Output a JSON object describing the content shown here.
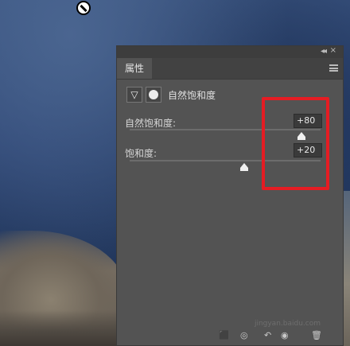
{
  "panel": {
    "tab_label": "属性",
    "adjustment_title": "自然饱和度",
    "vibrance": {
      "label": "自然饱和度:",
      "value": "+80",
      "level": 80
    },
    "saturation": {
      "label": "饱和度:",
      "value": "+20",
      "level": 20
    }
  },
  "footer": {
    "icons": [
      "clip-to-layer-icon",
      "view-previous-icon",
      "reset-icon",
      "visibility-eye-icon",
      "trash-icon"
    ]
  },
  "watermark": "jingyan.baidu.com",
  "colors": {
    "panel_bg": "#535353",
    "highlight": "#e51c23"
  }
}
